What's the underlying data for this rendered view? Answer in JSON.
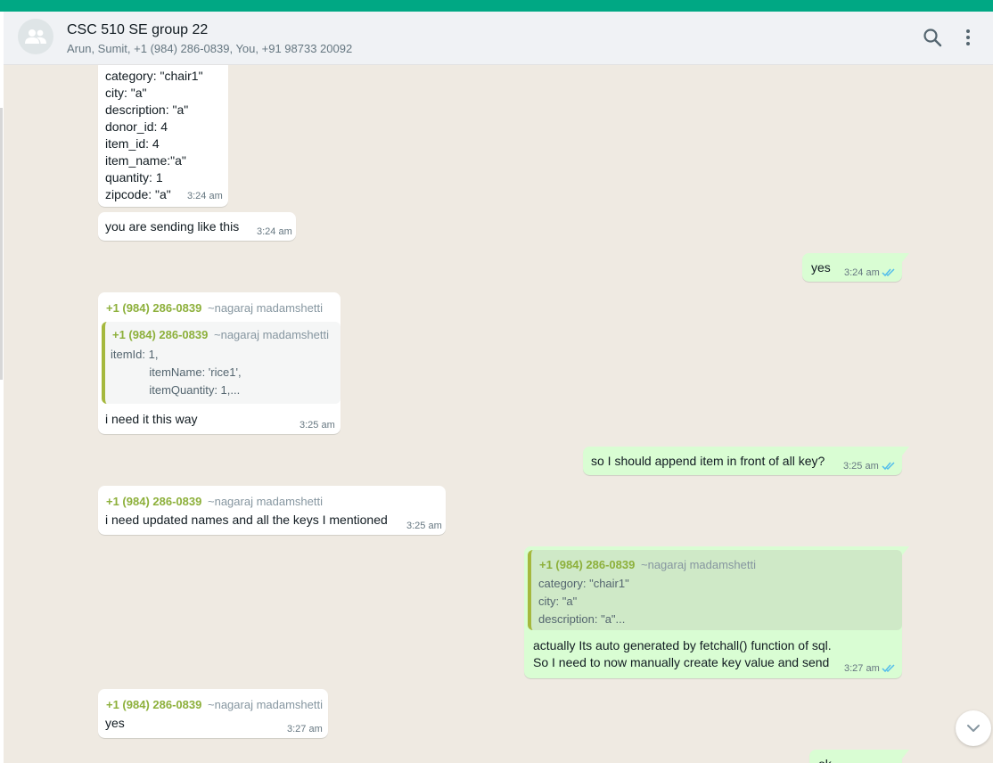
{
  "header": {
    "title": "CSC 510 SE group 22",
    "members": "Arun, Sumit, +1 (984) 286-0839, You, +91 98733 20092",
    "icons": [
      "group-avatar-icon",
      "search-icon",
      "menu-icon"
    ]
  },
  "colors": {
    "top_bar": "#00a884",
    "incoming_bubble": "#ffffff",
    "outgoing_bubble": "#d9fdd3",
    "sender_name": "#8db03b",
    "read_ticks": "#53bdeb"
  },
  "messages": [
    {
      "direction": "in",
      "lines": [
        "category: \"chair1\"",
        "city: \"a\"",
        "description: \"a\"",
        "donor_id: 4",
        "item_id: 4",
        "item_name:\"a\"",
        "quantity: 1",
        "zipcode: \"a\""
      ],
      "time": "3:24 am"
    },
    {
      "direction": "in",
      "text": "you are sending like this",
      "time": "3:24 am"
    },
    {
      "direction": "out",
      "text": "yes",
      "time": "3:24 am"
    },
    {
      "direction": "in",
      "sender": "+1 (984) 286-0839",
      "alias": "~nagaraj madamshetti",
      "quote": {
        "sender": "+1 (984) 286-0839",
        "alias": "~nagaraj madamshetti",
        "lines": [
          "itemId: 1,",
          "            itemName: 'rice1',",
          "            itemQuantity: 1,..."
        ]
      },
      "text": "i need it this way",
      "time": "3:25 am"
    },
    {
      "direction": "out",
      "text": "so I should append item in front of all key?",
      "time": "3:25 am"
    },
    {
      "direction": "in",
      "sender": "+1 (984) 286-0839",
      "alias": "~nagaraj madamshetti",
      "text": "i need updated names and all the keys I mentioned",
      "time": "3:25 am"
    },
    {
      "direction": "out",
      "quote": {
        "sender": "+1 (984) 286-0839",
        "alias": "~nagaraj madamshetti",
        "lines": [
          "category: \"chair1\"",
          "city: \"a\"",
          "description: \"a\"..."
        ]
      },
      "lines": [
        "actually Its auto generated by fetchall() function of sql.",
        "So I need to now manually create key value and send"
      ],
      "time": "3:27 am"
    },
    {
      "direction": "in",
      "sender": "+1 (984) 286-0839",
      "alias": "~nagaraj madamshetti",
      "text": "yes",
      "time": "3:27 am"
    },
    {
      "direction": "out",
      "text": "ok"
    }
  ]
}
